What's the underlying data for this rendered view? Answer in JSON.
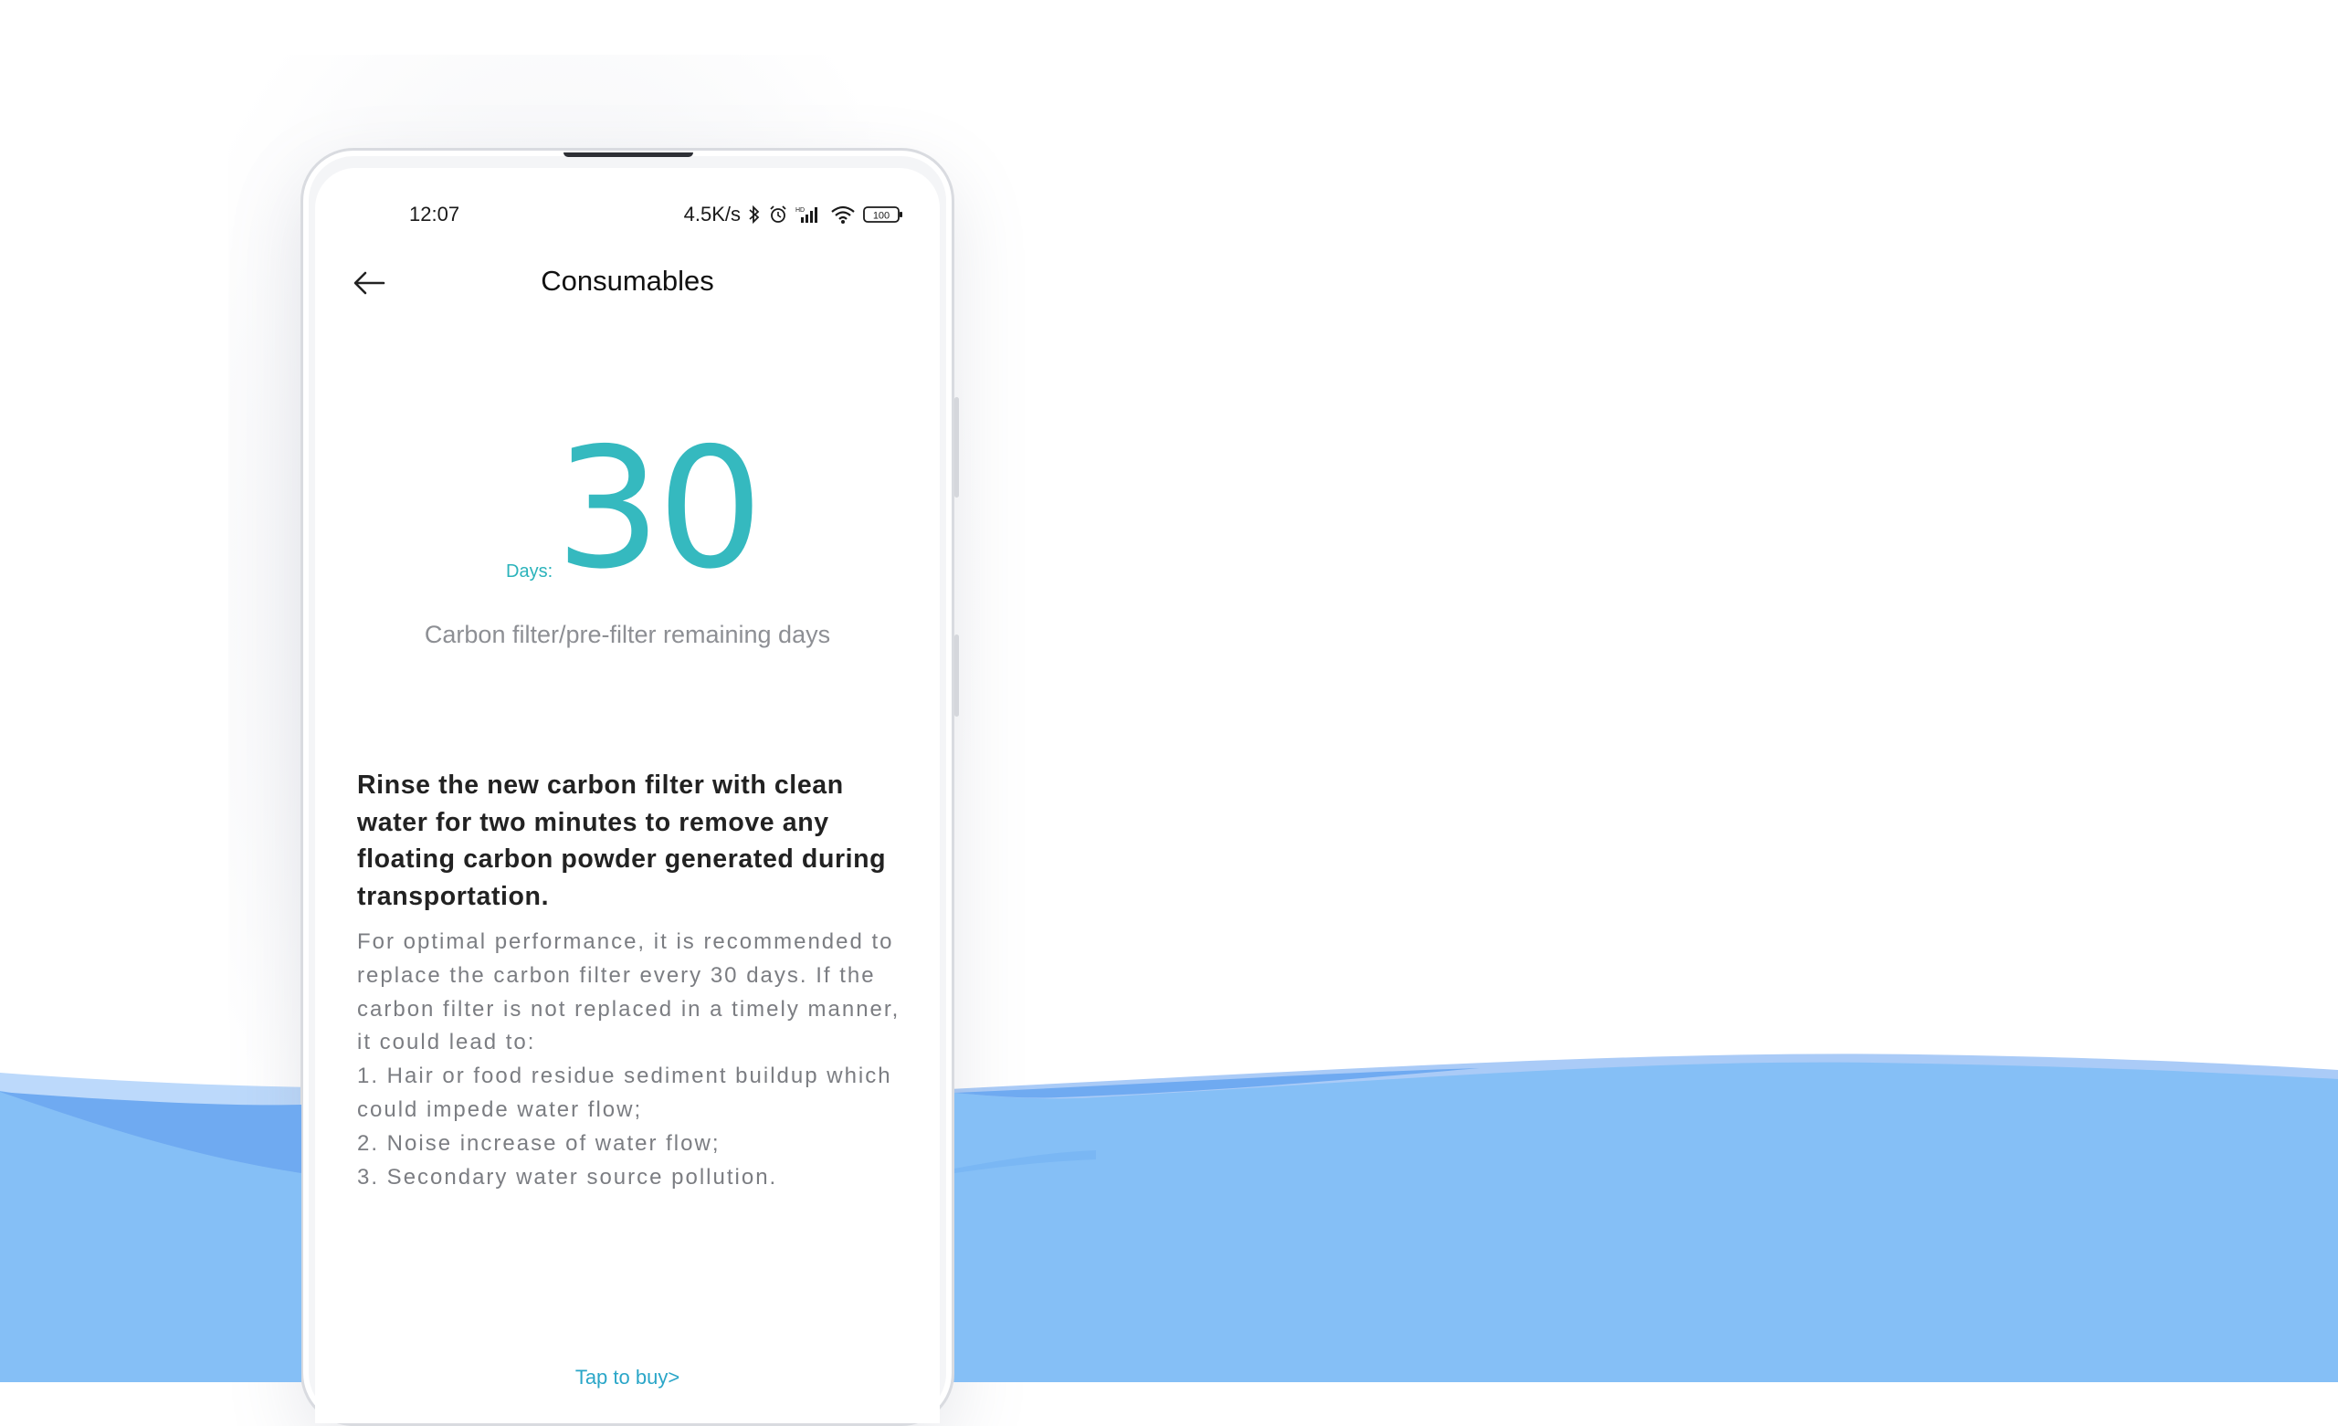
{
  "colors": {
    "accent": "#35b9bf",
    "wave_light": "#bcd9fb",
    "wave_main": "#85bff6",
    "wave_dark": "#6faaf1",
    "link": "#2aa6c8"
  },
  "status_bar": {
    "time": "12:07",
    "net_speed": "4.5K/s",
    "icons": [
      "bluetooth-icon",
      "alarm-icon",
      "signal-icon",
      "wifi-icon",
      "battery-icon"
    ],
    "battery": "100"
  },
  "header": {
    "back_icon": "arrow-left-icon",
    "title": "Consumables"
  },
  "remaining": {
    "days_label": "Days:",
    "value": "30",
    "caption": "Carbon filter/pre-filter remaining days"
  },
  "instructions": {
    "title": "Rinse the new carbon filter with clean water for two minutes to remove any floating carbon powder generated during transportation.",
    "intro": "For optimal performance, it is recommended to replace the carbon filter every 30 days. If the carbon filter is not replaced in a timely manner, it could lead to:",
    "items": [
      "1. Hair or food residue sediment buildup which could impede water flow;",
      "2. Noise increase of water flow;",
      "3. Secondary water source pollution."
    ]
  },
  "footer": {
    "tap_to_buy": "Tap to buy>"
  }
}
